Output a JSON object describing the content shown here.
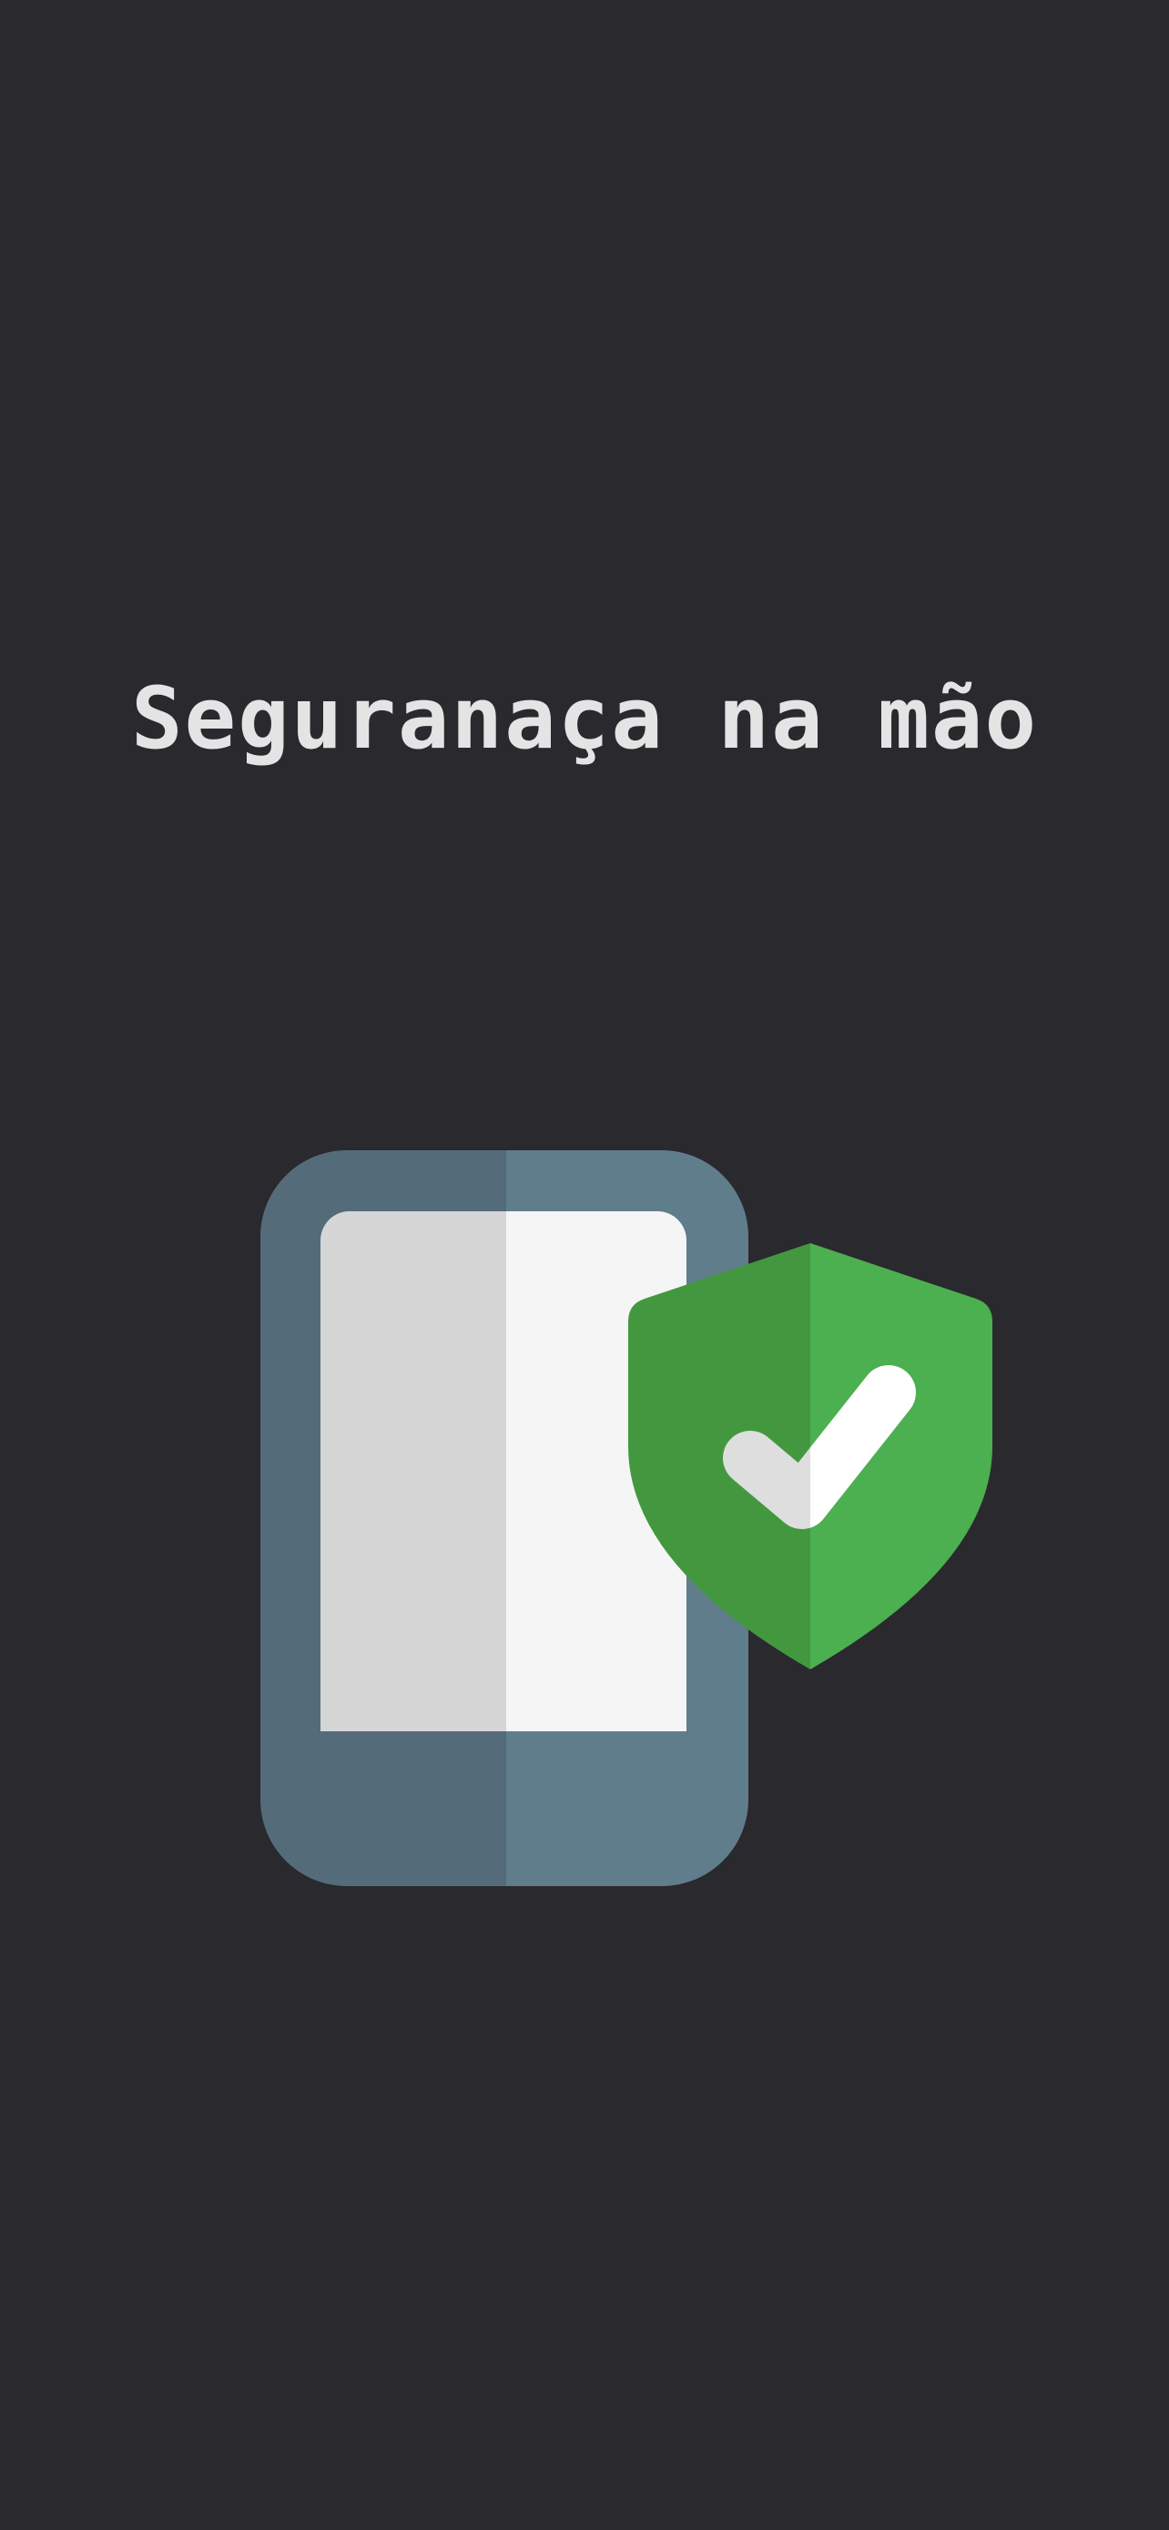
{
  "screen": {
    "title": "Seguranaça na mão"
  },
  "illustration": {
    "icons": [
      "smartphone-icon",
      "shield-check-icon"
    ],
    "colors": {
      "background": "#2a292e",
      "title_text": "#e4e4e4",
      "phone_body_dark": "#546c7a",
      "phone_body_light": "#607d8b",
      "phone_screen_left": "#d6d6d6",
      "phone_screen_right": "#f5f5f5",
      "shield_dark": "#43983f",
      "shield_light": "#4caf50",
      "check_left": "#dedede",
      "check_right": "#ffffff"
    }
  }
}
